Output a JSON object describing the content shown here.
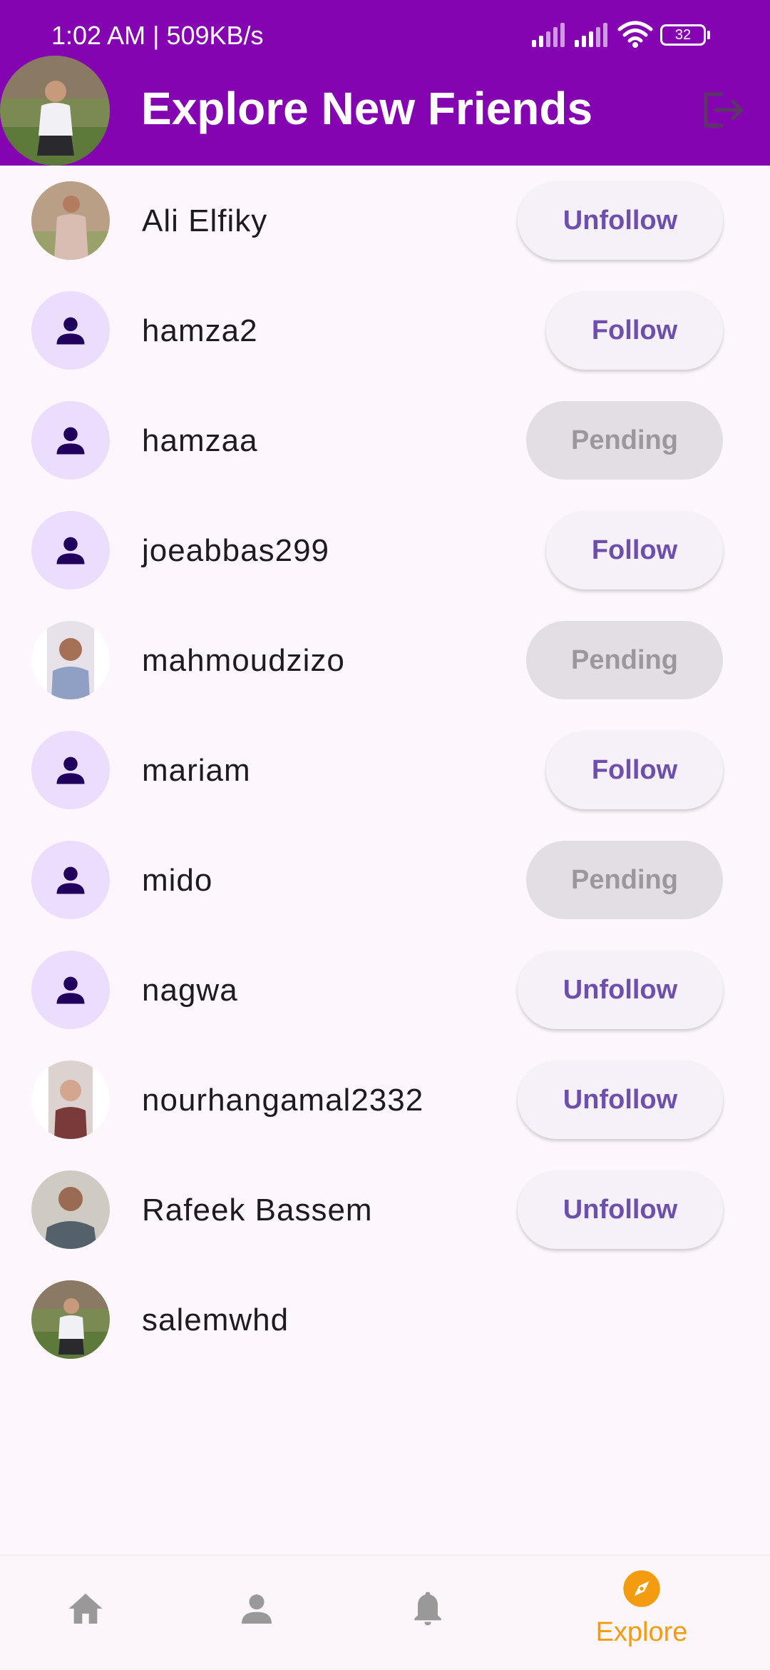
{
  "status_bar": {
    "time": "1:02 AM | 509KB/s",
    "battery": "32"
  },
  "header": {
    "title": "Explore New Friends"
  },
  "users": [
    {
      "name": "Ali Elfiky",
      "action": "Unfollow",
      "avatar": "photo"
    },
    {
      "name": "hamza2",
      "action": "Follow",
      "avatar": "default-person-icon"
    },
    {
      "name": "hamzaa",
      "action": "Pending",
      "avatar": "default-person-icon"
    },
    {
      "name": "joeabbas299",
      "action": "Follow",
      "avatar": "default-person-icon"
    },
    {
      "name": "mahmoudzizo",
      "action": "Pending",
      "avatar": "photo"
    },
    {
      "name": "mariam",
      "action": "Follow",
      "avatar": "default-person-icon"
    },
    {
      "name": "mido",
      "action": "Pending",
      "avatar": "default-person-icon"
    },
    {
      "name": "nagwa",
      "action": "Unfollow",
      "avatar": "default-person-icon"
    },
    {
      "name": "nourhangamal2332",
      "action": "Unfollow",
      "avatar": "photo"
    },
    {
      "name": "Rafeek Bassem",
      "action": "Unfollow",
      "avatar": "photo"
    },
    {
      "name": "salemwhd",
      "action": "",
      "avatar": "photo"
    }
  ],
  "bottom_nav": {
    "items": [
      {
        "icon": "home-icon",
        "label": ""
      },
      {
        "icon": "person-icon",
        "label": ""
      },
      {
        "icon": "bell-icon",
        "label": ""
      },
      {
        "icon": "compass-icon",
        "label": "Explore",
        "active": true
      }
    ]
  },
  "colors": {
    "header": "#8404b2",
    "button_text": "#6d50ad",
    "active_nav": "#f49c10",
    "inactive_nav": "#999999",
    "avatar_bg": "#ebdefc",
    "person_icon": "#22005d"
  }
}
